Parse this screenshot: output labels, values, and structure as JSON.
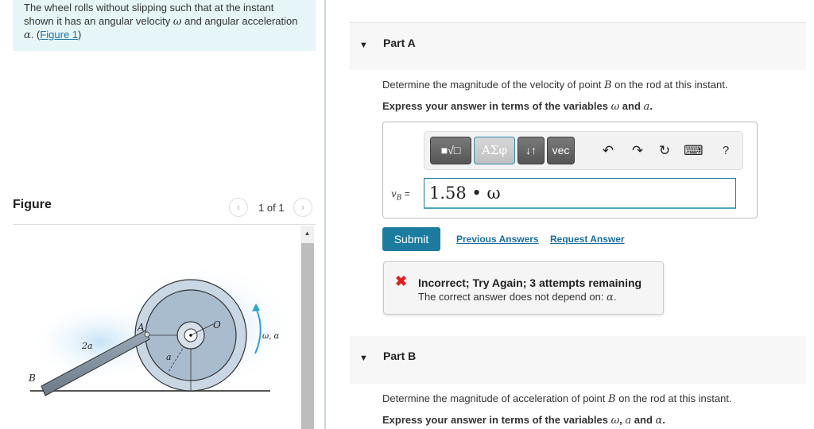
{
  "intro": {
    "text_before": "The wheel rolls without slipping such that at the instant shown it has an angular velocity ",
    "omega": "ω",
    "text_mid": " and angular acceleration ",
    "alpha": "α",
    "text_after": ". (",
    "figure_link": "Figure 1",
    "close": ")"
  },
  "figure": {
    "title": "Figure",
    "pager_text": "1 of 1",
    "prev_icon": "‹",
    "next_icon": "›",
    "labels": {
      "A": "A",
      "B": "B",
      "O": "O",
      "rod_length": "2a",
      "radius": "a",
      "rotation": "ω, α"
    },
    "scroll_up_icon": "▲"
  },
  "partA": {
    "title": "Part A",
    "question_pre": "Determine the magnitude of the velocity of point ",
    "question_var": "B",
    "question_post": " on the rod at this instant.",
    "instruction_pre": "Express your answer in terms of the variables ",
    "instruction_v1": "ω",
    "instruction_mid": " and ",
    "instruction_v2": "a",
    "instruction_post": ".",
    "toolbar": {
      "templates": "■√□",
      "greek": "ΑΣφ",
      "arrows": "↓↑",
      "vec": "vec",
      "undo": "↶",
      "redo": "↷",
      "reset": "↻",
      "keyboard": "⌨",
      "help": "?"
    },
    "var_label": "v",
    "var_sub": "B",
    "var_eq": " =",
    "answer_value": "1.58 • ω",
    "submit": "Submit",
    "previous_answers": "Previous Answers",
    "request_answer": "Request Answer",
    "feedback": {
      "icon": "✖",
      "title": "Incorrect; Try Again; 3 attempts remaining",
      "message_pre": "The correct answer does not depend on: ",
      "message_var": "α",
      "message_post": "."
    }
  },
  "partB": {
    "title": "Part B",
    "question_pre": "Determine the magnitude of acceleration of point ",
    "question_var": "B",
    "question_post": " on the rod at this instant.",
    "instruction_pre": "Express your answer in terms of the variables ",
    "instruction_v1": "ω",
    "instruction_sep": ", ",
    "instruction_v2": "a",
    "instruction_mid": " and ",
    "instruction_v3": "α",
    "instruction_post": "."
  },
  "colors": {
    "accent": "#1b7ca0",
    "error": "#e02020",
    "intro_bg": "#e6f5f7"
  }
}
